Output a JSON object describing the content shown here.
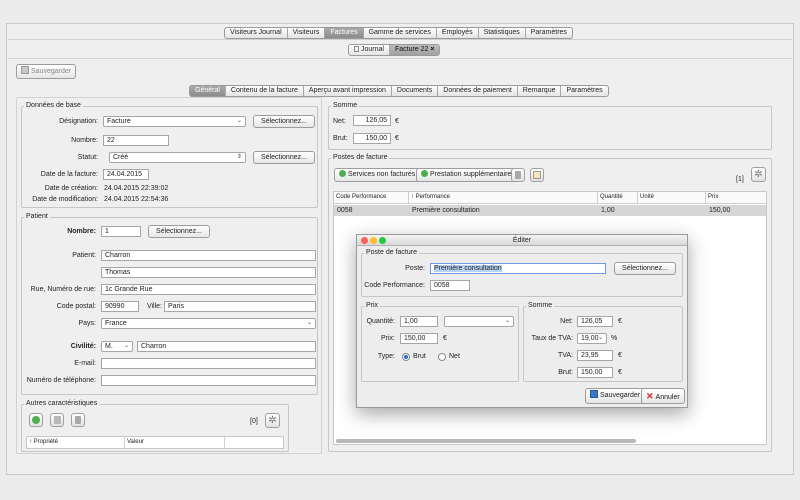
{
  "top_tabs": [
    "Visiteurs Journal",
    "Visiteurs",
    "Factures",
    "Gamme de services",
    "Employés",
    "Statistiques",
    "Paramètres"
  ],
  "sub_tabs": [
    {
      "label": "Journal"
    },
    {
      "label": "Facture 22",
      "close": "×"
    }
  ],
  "save_button": "Sauvegarder",
  "inner_tabs": [
    "Général",
    "Contenu de la facture",
    "Aperçu avant impression",
    "Documents",
    "Données de paiement",
    "Remarque",
    "Paramètres"
  ],
  "base_data": {
    "title": "Données de base",
    "designation_label": "Désignation:",
    "designation_value": "Facture",
    "select_label": "Sélectionnez...",
    "number_label": "Nombre:",
    "number_value": "22",
    "status_label": "Statut:",
    "status_value": "Créé",
    "status_select": "Sélectionnez...",
    "invoice_date_label": "Date de la facture:",
    "invoice_date_value": "24.04.2015",
    "created_label": "Date de création:",
    "created_value": "24.04.2015 22:39:02",
    "modified_label": "Date de modification:",
    "modified_value": "24.04.2015 22:54:36"
  },
  "patient": {
    "title": "Patient",
    "number_label": "Nombre:",
    "number_value": "1",
    "select_label": "Sélectionnez...",
    "patient_label": "Patient:",
    "lastname": "Charron",
    "firstname": "Thomas",
    "street_label": "Rue, Numéro de rue:",
    "street_value": "1c Grande Rue",
    "postal_label": "Code postal:",
    "postal_value": "90990",
    "city_label": "Ville:",
    "city_value": "Paris",
    "country_label": "Pays:",
    "country_value": "France",
    "civility_label": "Civilité:",
    "civility_value": "M.",
    "civility_name": "Charron",
    "email_label": "E-mail:",
    "email_value": "",
    "phone_label": "Numéro de téléphone:",
    "phone_value": ""
  },
  "other": {
    "title": "Autres caractéristiques",
    "count": "[0]",
    "col_property": "↑ Propriété",
    "col_value": "Valeur"
  },
  "sum": {
    "title": "Somme",
    "net_label": "Net:",
    "net_value": "126,05",
    "net_cur": "€",
    "gross_label": "Brut:",
    "gross_value": "150,00",
    "gross_cur": "€"
  },
  "positions": {
    "title": "Postes de facture",
    "btn_unbilled": "Services non facturés",
    "btn_additional": "Prestation supplémentaire",
    "count": "[1]",
    "columns": [
      "Code Performance",
      "↑ Performance",
      "Quantité",
      "Unité",
      "Prix"
    ],
    "rows": [
      [
        "0058",
        "Première consultation",
        "1,00",
        "",
        "150,00"
      ]
    ]
  },
  "dialog": {
    "title": "Éditer",
    "pos_group": "Poste de facture",
    "poste_label": "Poste:",
    "poste_value": "Première consultation",
    "select_label": "Sélectionnez...",
    "code_label": "Code Performance:",
    "code_value": "0058",
    "price_group": "Prix",
    "qty_label": "Quantité:",
    "qty_value": "1,00",
    "unit_value": "",
    "price_label": "Prix:",
    "price_value": "150,00",
    "price_cur": "€",
    "type_label": "Type:",
    "type_gross": "Brut",
    "type_net": "Net",
    "sum_group": "Somme",
    "net_label": "Net:",
    "net_value": "126,05",
    "net_cur": "€",
    "vat_rate_label": "Taux de TVA:",
    "vat_rate_value": "19,00",
    "vat_rate_unit": "%",
    "vat_label": "TVA:",
    "vat_value": "23,95",
    "vat_cur": "€",
    "gross_label": "Brut:",
    "gross_value": "150,00",
    "gross_cur": "€",
    "save": "Sauvegarder",
    "cancel": "Annuler"
  }
}
